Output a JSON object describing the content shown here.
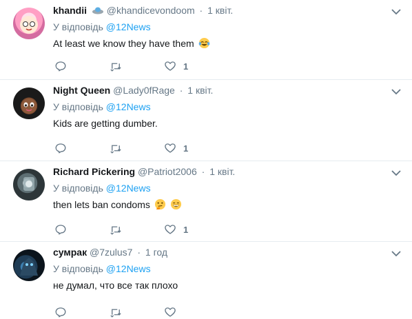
{
  "tweets": [
    {
      "name": "khandii",
      "handle": "@khandicevondoom",
      "dot": "·",
      "time": "1 квіт.",
      "reply_prefix": "У відповідь",
      "reply_mention": "@12News",
      "text": "At least we know they have them",
      "emojis": [
        "laughing-tears-emoji"
      ],
      "like_count": "1"
    },
    {
      "name": "Night Queen",
      "handle": "@Lady0fRage",
      "dot": "·",
      "time": "1 квіт.",
      "reply_prefix": "У відповідь",
      "reply_mention": "@12News",
      "text": "Kids are getting dumber.",
      "emojis": [],
      "like_count": "1"
    },
    {
      "name": "Richard Pickering",
      "handle": "@Patriot2006",
      "dot": "·",
      "time": "1 квіт.",
      "reply_prefix": "У відповідь",
      "reply_mention": "@12News",
      "text": "then lets ban condoms",
      "emojis": [
        "thinking-emoji",
        "grinning-emoji"
      ],
      "like_count": "1"
    },
    {
      "name": "сумрак",
      "handle": "@7zulus7",
      "dot": "·",
      "time": "1 год",
      "reply_prefix": "У відповідь",
      "reply_mention": "@12News",
      "text": "не думал, что все так плохо",
      "emojis": [],
      "like_count": ""
    }
  ],
  "colors": {
    "link": "#1da1f2",
    "muted": "#657786",
    "text": "#14171a",
    "divider": "#e6ecf0"
  }
}
